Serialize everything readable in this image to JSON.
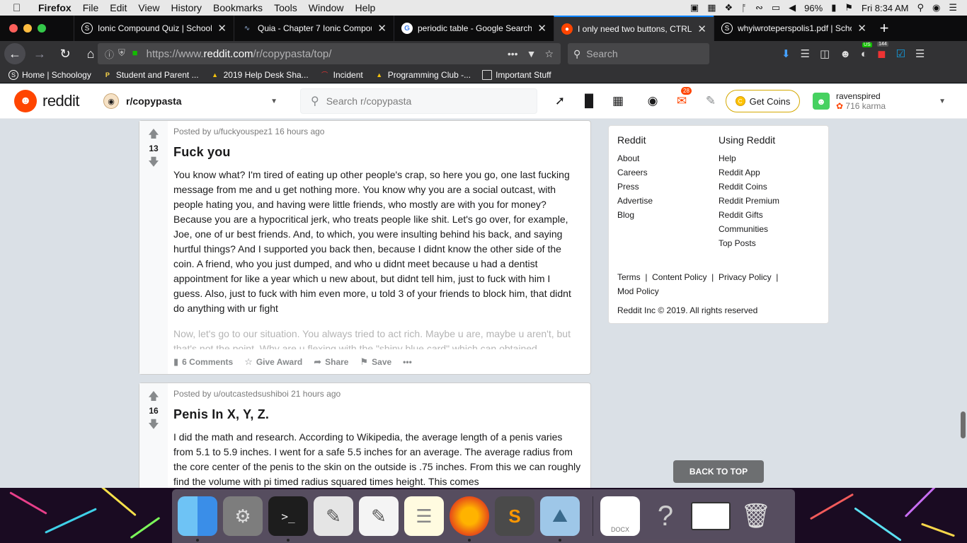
{
  "menubar": {
    "app": "Firefox",
    "items": [
      "File",
      "Edit",
      "View",
      "History",
      "Bookmarks",
      "Tools",
      "Window",
      "Help"
    ],
    "battery": "96%",
    "clock": "Fri 8:34 AM"
  },
  "tabs": [
    {
      "label": "Ionic Compound Quiz | Schoolo",
      "icon": "schoology-icon",
      "color": "#4b83c4"
    },
    {
      "label": "Quia - Chapter 7 Ionic Compou",
      "icon": "quia-icon",
      "color": "#3a5a8c"
    },
    {
      "label": "periodic table - Google Search",
      "icon": "google-icon",
      "color": "#ffffff"
    },
    {
      "label": "I only need two buttons, CTRL-",
      "icon": "reddit-icon",
      "color": "#ff4500"
    },
    {
      "label": "whyiwroteperspolis1.pdf | Scho",
      "icon": "schoology-icon",
      "color": "#4b83c4"
    }
  ],
  "navbar": {
    "url_prefix": "https://www.",
    "url_host": "reddit.com",
    "url_path": "/r/copypasta/top/",
    "search_placeholder": "Search",
    "badge_us": "US",
    "badge_count": "144"
  },
  "bookmarks": [
    {
      "label": "Home | Schoology",
      "icon": "schoology-icon"
    },
    {
      "label": "Student and Parent ...",
      "icon": "powerschool-icon"
    },
    {
      "label": "2019 Help Desk Sha...",
      "icon": "drive-icon"
    },
    {
      "label": "Incident",
      "icon": "incident-icon"
    },
    {
      "label": "Programming Club -...",
      "icon": "drive-icon"
    },
    {
      "label": "Important Stuff",
      "icon": "folder-icon"
    }
  ],
  "reddit_header": {
    "logo": "reddit",
    "subreddit": "r/copypasta",
    "search_placeholder": "Search r/copypasta",
    "notif_count": "28",
    "get_coins": "Get Coins",
    "username": "ravenspired",
    "karma": "716 karma"
  },
  "posts": [
    {
      "score": "13",
      "meta": "Posted by u/fuckyouspez1 16 hours ago",
      "title": "Fuck you",
      "body": "You know what? I'm tired of eating up other people's crap, so here you go, one last fucking message from me and u get nothing more. You know why you are a social outcast, with people hating you, and having were little friends, who mostly are with you for money? Because you are a hypocritical jerk, who treats people like shit. Let's go over, for example, Joe, one of ur best friends. And, to which, you were insulting behind his back, and saying hurtful things? And I supported you back then, because I didnt know the other side of the coin. A friend, who you just dumped, and who u didnt meet because u had a dentist appointment for like a year which u new about, but didnt tell him, just to fuck with him I guess. Also, just to fuck with him even more, u told 3 of your friends to block him, that didnt do anything with ur fight",
      "faded": "Now, let's go to our situation. You always tried to act rich. Maybe u are, maybe u aren't, but that's not the point. Why are u flexing with the \"shiny blue card\" which can obtained",
      "comments": "6 Comments",
      "award": "Give Award",
      "share": "Share",
      "save": "Save",
      "more": "•••"
    },
    {
      "score": "16",
      "meta": "Posted by u/outcastedsushiboi 21 hours ago",
      "title": "Penis In X, Y, Z.",
      "body": "I did the math and research. According to Wikipedia, the average length of a penis varies from 5.1 to 5.9 inches. I went for a safe 5.5 inches for an average. The average radius from the core center of the penis to the skin on the outside is .75 inches. From this we can roughly find the volume with pi timed radius squared times height. This comes"
    }
  ],
  "sidebar": {
    "col1_head": "Reddit",
    "col1": [
      "About",
      "Careers",
      "Press",
      "Advertise",
      "Blog"
    ],
    "col2_head": "Using Reddit",
    "col2": [
      "Help",
      "Reddit App",
      "Reddit Coins",
      "Reddit Premium",
      "Reddit Gifts",
      "Communities",
      "Top Posts"
    ],
    "legal_line": "Terms  |  Content Policy  |  Privacy Policy  |",
    "legal_line2": "Mod Policy",
    "copyright": "Reddit Inc © 2019. All rights reserved"
  },
  "back_to_top": "BACK TO TOP",
  "dock": [
    "finder-icon",
    "system-preferences-icon",
    "terminal-icon",
    "script-editor-icon",
    "textedit-icon",
    "notes-icon",
    "firefox-icon",
    "sublime-text-icon",
    "preview-icon",
    "docx-file-icon",
    "help-icon",
    "window-icon",
    "trash-icon"
  ]
}
